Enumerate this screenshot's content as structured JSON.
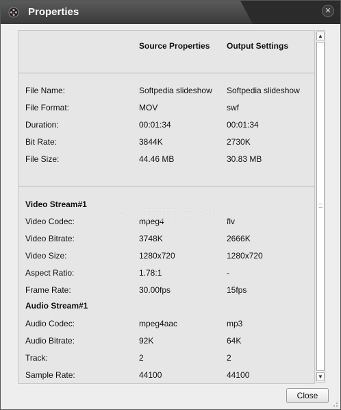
{
  "window": {
    "title": "Properties"
  },
  "headers": {
    "source": "Source Properties",
    "output": "Output Settings"
  },
  "general": [
    {
      "label": "File Name:",
      "source": "Softpedia slideshow",
      "output": "Softpedia slideshow"
    },
    {
      "label": "File Format:",
      "source": "MOV",
      "output": "swf"
    },
    {
      "label": "Duration:",
      "source": "00:01:34",
      "output": "00:01:34"
    },
    {
      "label": "Bit Rate:",
      "source": "3844K",
      "output": "2730K"
    },
    {
      "label": "File Size:",
      "source": "44.46 MB",
      "output": "30.83 MB"
    }
  ],
  "video": {
    "title": "Video Stream#1",
    "rows": [
      {
        "label": "Video Codec:",
        "source": "mpeg4",
        "output": "flv"
      },
      {
        "label": "Video Bitrate:",
        "source": "3748K",
        "output": "2666K"
      },
      {
        "label": "Video Size:",
        "source": "1280x720",
        "output": "1280x720"
      },
      {
        "label": "Aspect Ratio:",
        "source": "1.78:1",
        "output": "-"
      },
      {
        "label": "Frame Rate:",
        "source": "30.00fps",
        "output": "15fps"
      }
    ]
  },
  "audio": {
    "title": "Audio Stream#1",
    "rows": [
      {
        "label": "Audio Codec:",
        "source": "mpeg4aac",
        "output": "mp3"
      },
      {
        "label": "Audio Bitrate:",
        "source": "92K",
        "output": "64K"
      },
      {
        "label": "Track:",
        "source": "2",
        "output": "2"
      },
      {
        "label": "Sample Rate:",
        "source": "44100",
        "output": "44100"
      }
    ]
  },
  "watermark": "SOFTPEDIA",
  "buttons": {
    "close": "Close"
  },
  "icons": {
    "app": "film-reel-icon",
    "close": "close-icon",
    "scroll_up": "arrow-up-icon",
    "scroll_down": "arrow-down-icon"
  }
}
